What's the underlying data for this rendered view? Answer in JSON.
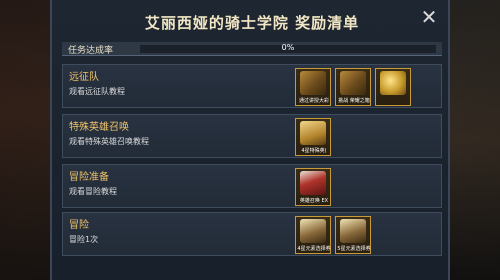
{
  "dialog": {
    "title": "艾丽西娅的骑士学院 奖励清单",
    "close_glyph": "✕"
  },
  "progress": {
    "label": "任务达成率",
    "value_text": "0%",
    "fraction": 0
  },
  "rows": [
    {
      "title": "远征队",
      "subtitle": "观看远征队教程",
      "rewards": [
        {
          "icon": "treasure-chest-icon",
          "caption": "通过讲授大彩",
          "art": "chest"
        },
        {
          "icon": "treasure-chest-icon",
          "caption": "挑战 荣耀之箱",
          "art": "chest"
        },
        {
          "icon": "gold-coins-icon",
          "caption": "",
          "art": "coins"
        }
      ]
    },
    {
      "title": "特殊英雄召唤",
      "subtitle": "观看特殊英雄召唤教程",
      "rewards": [
        {
          "icon": "hero-card-icon",
          "caption": "4星特殊英(",
          "art": "card-gold"
        }
      ]
    },
    {
      "title": "冒险准备",
      "subtitle": "观看冒险教程",
      "rewards": [
        {
          "icon": "hero-card-icon",
          "caption": "英雄召唤 EX",
          "art": "card-red"
        }
      ]
    },
    {
      "title": "冒险",
      "subtitle": "冒险1次",
      "rewards": [
        {
          "icon": "hero-card-icon",
          "caption": "4星元素选择券",
          "art": "card-green"
        },
        {
          "icon": "hero-card-icon",
          "caption": "5星元素选择券",
          "art": "card-green"
        }
      ]
    }
  ]
}
